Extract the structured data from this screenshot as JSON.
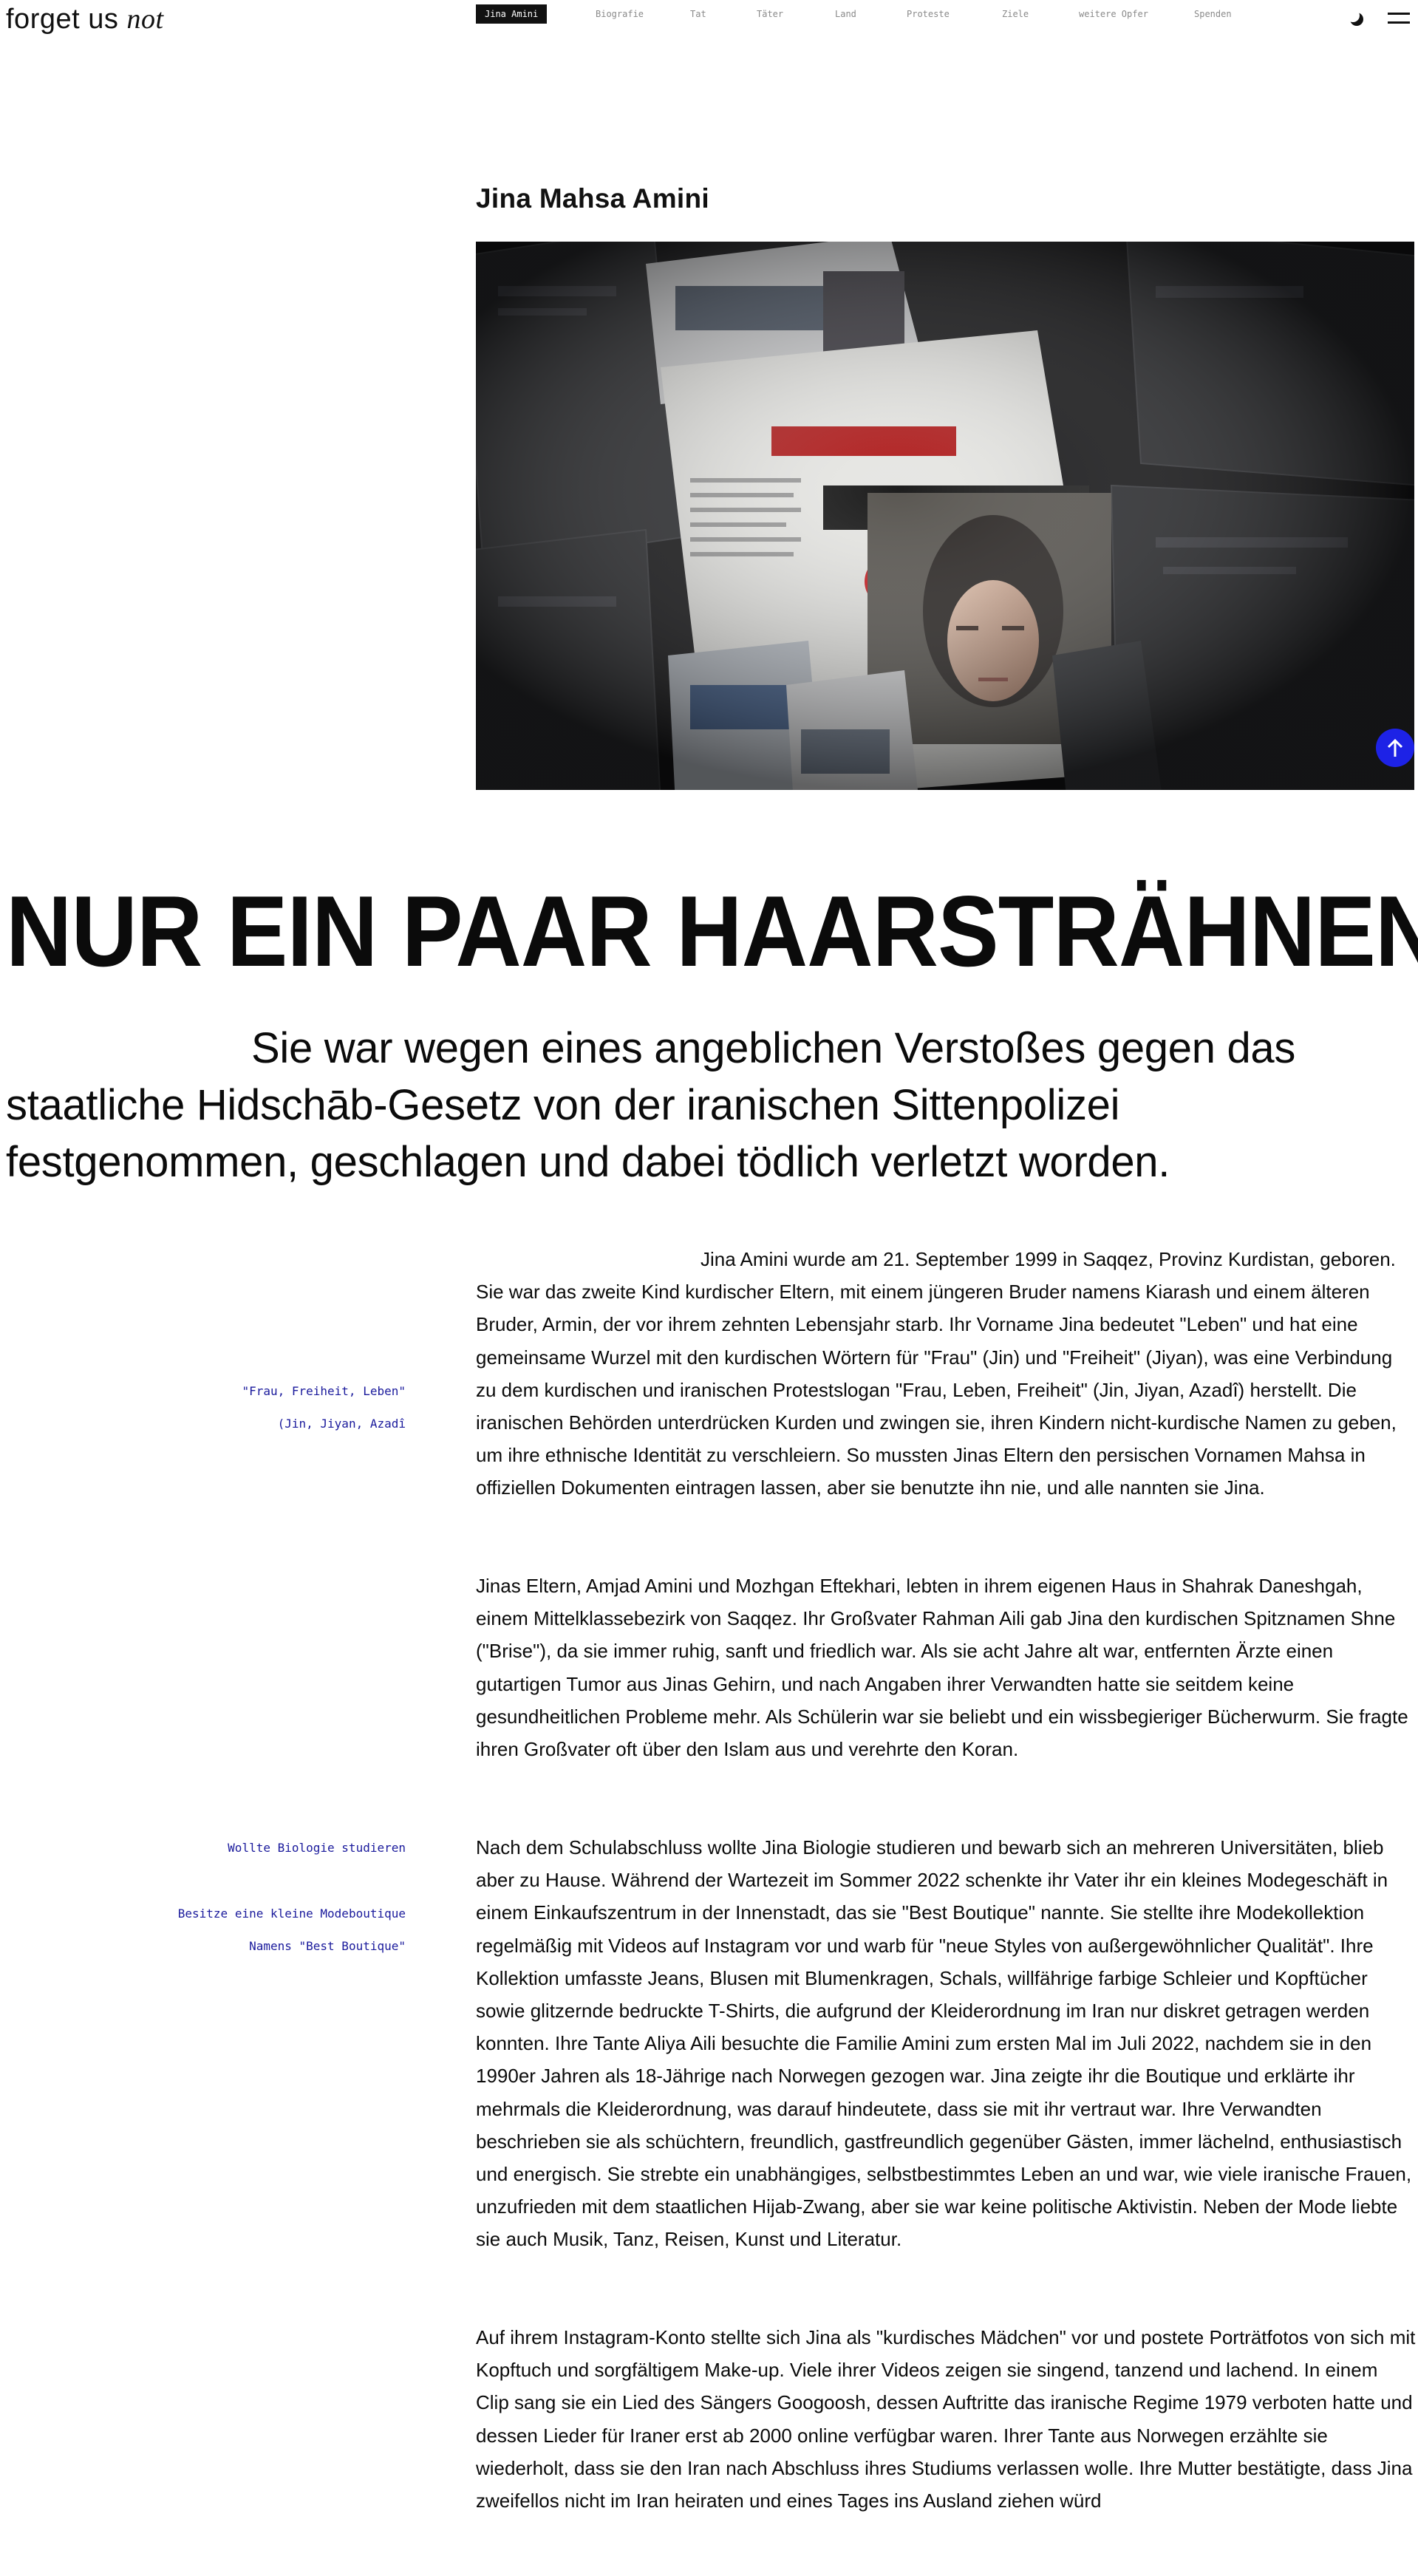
{
  "header": {
    "logo_main": "forget us",
    "logo_em": "not",
    "nav": [
      "Jina Amini",
      "Biografie",
      "Tat",
      "Täter",
      "Land",
      "Proteste",
      "Ziele",
      "weitere Opfer",
      "Spenden"
    ],
    "active_nav_index": 0,
    "icons": [
      "moon-icon",
      "hamburger-menu-icon"
    ]
  },
  "hero": {
    "name": "Jina Mahsa Amini",
    "image_subject": "newspapers-with-portrait-of-jina-amini"
  },
  "article": {
    "headline": "NUR EIN PAAR HAARSTRÄHNEN",
    "lead": "Sie war wegen eines angeblichen Verstoßes gegen das staatliche Hidschāb-Gesetz von der iranischen Sittenpolizei festgenommen, geschlagen und dabei tödlich verletzt worden.",
    "side_notes": [
      "\"Frau, Freiheit, Leben\"",
      "(Jin, Jiyan, Azadî",
      "Wollte Biologie studieren",
      "Besitze eine kleine Modeboutique",
      "Namens \"Best Boutique\""
    ],
    "paragraphs": [
      "Jina Amini wurde am 21. September 1999 in Saqqez, Provinz Kurdistan, geboren. Sie war das zweite Kind kurdischer Eltern, mit einem jüngeren Bruder namens Kiarash und einem älteren Bruder, Armin, der vor ihrem zehnten Lebensjahr starb. Ihr Vorname Jina bedeutet \"Leben\" und hat eine gemeinsame Wurzel mit den kurdischen Wörtern für \"Frau\" (Jin) und \"Freiheit\" (Jiyan), was eine Verbindung zu dem kurdischen und iranischen Protestslogan \"Frau, Leben, Freiheit\" (Jin, Jiyan, Azadî) herstellt. Die iranischen Behörden unterdrücken Kurden und zwingen sie, ihren Kindern nicht-kurdische Namen zu geben, um ihre ethnische Identität zu verschleiern. So mussten Jinas Eltern den persischen Vornamen Mahsa in offiziellen Dokumenten eintragen lassen, aber sie benutzte ihn nie, und alle nannten sie Jina.",
      "Jinas Eltern, Amjad Amini und Mozhgan Eftekhari, lebten in ihrem eigenen Haus in Shahrak Daneshgah, einem Mittelklassebezirk von Saqqez. Ihr Großvater Rahman Aili gab Jina den kurdischen Spitznamen Shne (\"Brise\"), da sie immer ruhig, sanft und friedlich war. Als sie acht Jahre alt war, entfernten Ärzte einen gutartigen Tumor aus Jinas Gehirn, und nach Angaben ihrer Verwandten hatte sie seitdem keine gesundheitlichen Probleme mehr. Als Schülerin war sie beliebt und ein wissbegieriger Bücherwurm. Sie fragte ihren Großvater oft über den Islam aus und verehrte den Koran.",
      "Nach dem Schulabschluss wollte Jina Biologie studieren und bewarb sich an mehreren Universitäten, blieb aber zu Hause. Während der Wartezeit im Sommer 2022 schenkte ihr Vater ihr ein kleines Modegeschäft in einem Einkaufszentrum in der Innenstadt, das sie \"Best Boutique\" nannte. Sie stellte ihre Modekollektion regelmäßig mit Videos auf Instagram vor und warb für \"neue Styles von außergewöhnlicher Qualität\". Ihre Kollektion umfasste Jeans, Blusen mit Blumenkragen, Schals, willfährige farbige Schleier und Kopftücher sowie glitzernde bedruckte T-Shirts, die aufgrund der Kleiderordnung im Iran nur diskret getragen werden konnten. Ihre Tante Aliya Aili besuchte die Familie Amini zum ersten Mal im Juli 2022, nachdem sie in den 1990er Jahren als 18-Jährige nach Norwegen gezogen war. Jina zeigte ihr die Boutique und erklärte ihr mehrmals die Kleiderordnung, was darauf hindeutete, dass sie mit ihr vertraut war. Ihre Verwandten beschrieben sie als schüchtern, freundlich, gastfreundlich gegenüber Gästen, immer lächelnd, enthusiastisch und energisch. Sie strebte ein unabhängiges, selbstbestimmtes Leben an und war, wie viele iranische Frauen, unzufrieden mit dem staatlichen Hijab-Zwang, aber sie war keine politische Aktivistin. Neben der Mode liebte sie auch Musik, Tanz, Reisen, Kunst und Literatur.",
      "Auf ihrem Instagram-Konto stellte sich Jina als \"kurdisches Mädchen\" vor und postete Porträtfotos von sich mit Kopftuch und sorgfältigem Make-up. Viele ihrer Videos zeigen sie singend, tanzend und lachend. In einem Clip sang sie ein Lied des Sängers Googoosh, dessen Auftritte das iranische Regime 1979 verboten hatte und dessen Lieder für Iraner erst ab 2000 online verfügbar waren. Ihrer Tante aus Norwegen erzählte sie wiederholt, dass sie den Iran nach Abschluss ihres Studiums verlassen wolle. Ihre Mutter bestätigte, dass Jina zweifellos nicht im Iran heiraten und eines Tages ins Ausland ziehen würd"
    ]
  },
  "colors": {
    "accent_blue": "#1d22e6",
    "side_note_blue": "#1a1a9c",
    "text": "#0b0b0b",
    "nav_inactive": "#8a8a8a"
  }
}
